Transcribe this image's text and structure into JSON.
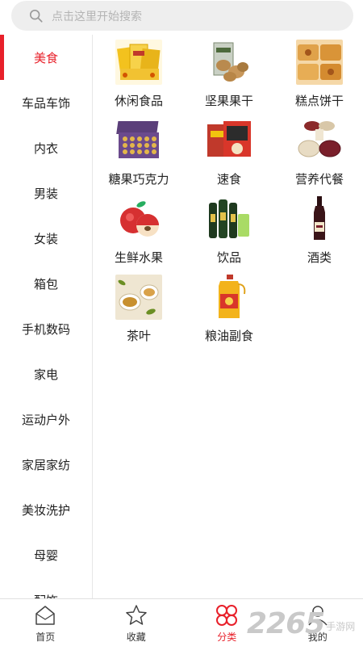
{
  "search": {
    "placeholder": "点击这里开始搜索"
  },
  "sidebar": {
    "items": [
      {
        "label": "美食",
        "active": true
      },
      {
        "label": "车品车饰"
      },
      {
        "label": "内衣"
      },
      {
        "label": "男装"
      },
      {
        "label": "女装"
      },
      {
        "label": "箱包"
      },
      {
        "label": "手机数码"
      },
      {
        "label": "家电"
      },
      {
        "label": "运动户外"
      },
      {
        "label": "家居家纺"
      },
      {
        "label": "美妆洗护"
      },
      {
        "label": "母婴"
      },
      {
        "label": "配饰"
      }
    ]
  },
  "categories": [
    {
      "label": "休闲食品",
      "icon": "snack-box-image"
    },
    {
      "label": "坚果果干",
      "icon": "nuts-bag-image"
    },
    {
      "label": "糕点饼干",
      "icon": "pastry-image"
    },
    {
      "label": "糖果巧克力",
      "icon": "chocolate-box-image"
    },
    {
      "label": "速食",
      "icon": "instant-noodle-image"
    },
    {
      "label": "营养代餐",
      "icon": "cereal-bowls-image"
    },
    {
      "label": "生鲜水果",
      "icon": "apple-image"
    },
    {
      "label": "饮品",
      "icon": "drink-bottles-image"
    },
    {
      "label": "酒类",
      "icon": "wine-bottle-image"
    },
    {
      "label": "茶叶",
      "icon": "tea-cups-image"
    },
    {
      "label": "粮油副食",
      "icon": "cooking-oil-image"
    }
  ],
  "tabbar": {
    "tabs": [
      {
        "label": "首页",
        "icon": "home-icon"
      },
      {
        "label": "收藏",
        "icon": "star-icon"
      },
      {
        "label": "分类",
        "icon": "category-icon",
        "active": true
      },
      {
        "label": "我的",
        "icon": "user-icon"
      }
    ]
  },
  "watermark": {
    "number": "2265",
    "text": "手游网"
  },
  "colors": {
    "accent": "#e8202a",
    "search_bg": "#eeeeee",
    "divider": "#e6e6e6"
  }
}
